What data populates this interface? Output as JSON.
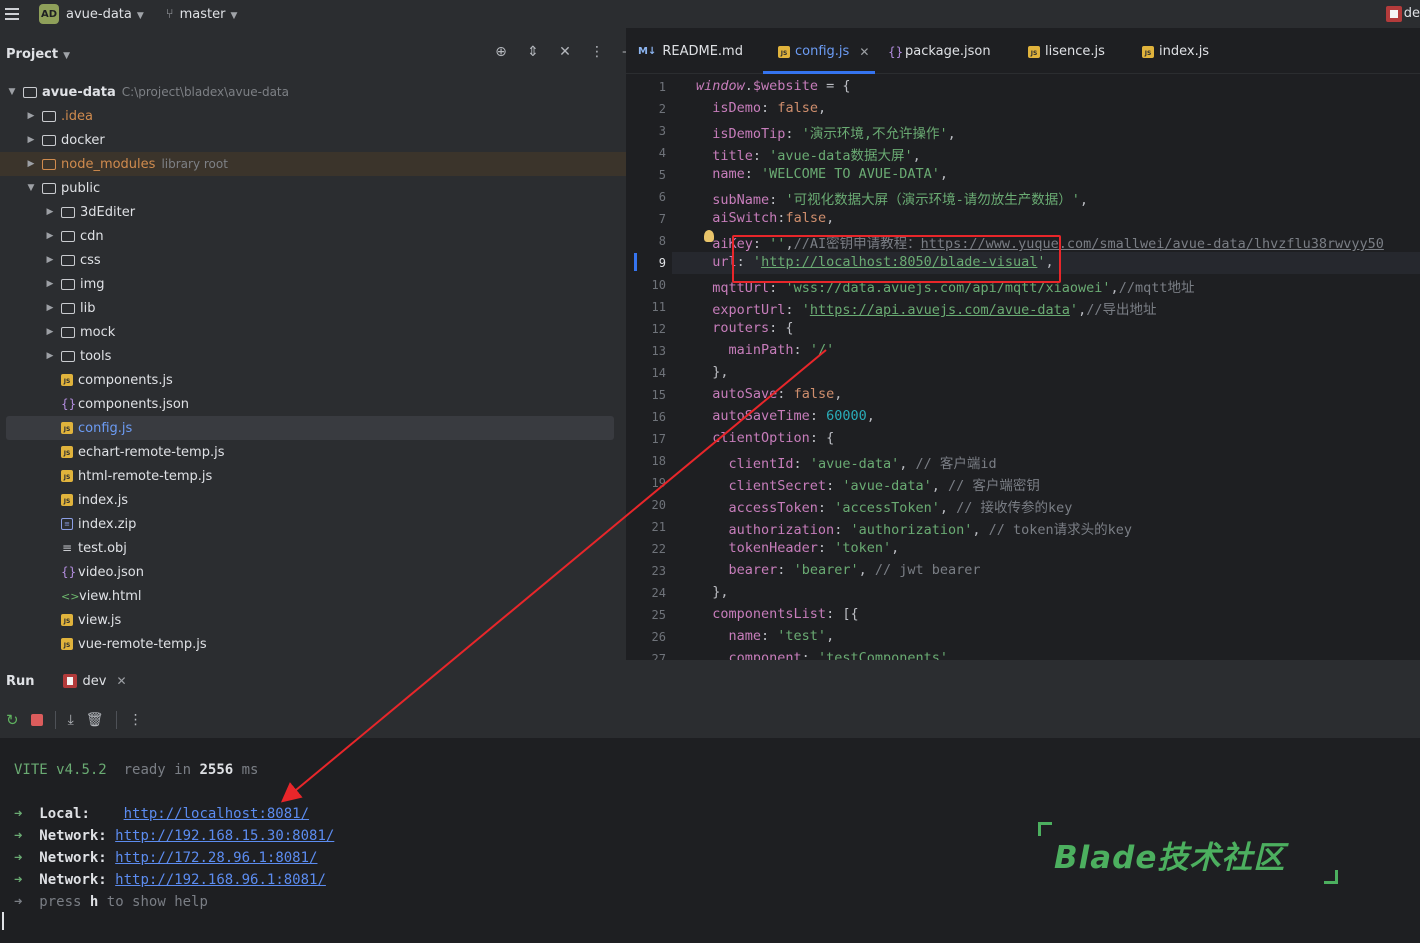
{
  "topbar": {
    "project_badge": "AD",
    "project_name": "avue-data",
    "branch_name": "master",
    "right_text": "de"
  },
  "project_panel": {
    "title": "Project",
    "tools": [
      "⊕",
      "⇕",
      "✕",
      "⋮",
      "—"
    ],
    "tree": [
      {
        "name": "avue-data",
        "hint": "C:\\project\\bladex\\avue-data",
        "type": "folder",
        "depth": 0,
        "expanded": true,
        "bold": true
      },
      {
        "name": ".idea",
        "type": "folder",
        "depth": 1,
        "expanded": false,
        "style": "orange-text"
      },
      {
        "name": "docker",
        "type": "folder",
        "depth": 1,
        "expanded": false
      },
      {
        "name": "node_modules",
        "hint": "library root",
        "type": "folder",
        "depth": 1,
        "expanded": false,
        "style": "excluded"
      },
      {
        "name": "public",
        "type": "folder",
        "depth": 1,
        "expanded": true
      },
      {
        "name": "3dEditer",
        "type": "folder",
        "depth": 2,
        "expanded": false
      },
      {
        "name": "cdn",
        "type": "folder",
        "depth": 2,
        "expanded": false
      },
      {
        "name": "css",
        "type": "folder",
        "depth": 2,
        "expanded": false
      },
      {
        "name": "img",
        "type": "folder",
        "depth": 2,
        "expanded": false
      },
      {
        "name": "lib",
        "type": "folder",
        "depth": 2,
        "expanded": false
      },
      {
        "name": "mock",
        "type": "folder",
        "depth": 2,
        "expanded": false
      },
      {
        "name": "tools",
        "type": "folder",
        "depth": 2,
        "expanded": false
      },
      {
        "name": "components.js",
        "type": "js",
        "depth": 2
      },
      {
        "name": "components.json",
        "type": "json",
        "depth": 2
      },
      {
        "name": "config.js",
        "type": "js",
        "depth": 2,
        "selected": true
      },
      {
        "name": "echart-remote-temp.js",
        "type": "js",
        "depth": 2
      },
      {
        "name": "html-remote-temp.js",
        "type": "js",
        "depth": 2
      },
      {
        "name": "index.js",
        "type": "js",
        "depth": 2
      },
      {
        "name": "index.zip",
        "type": "zip",
        "depth": 2
      },
      {
        "name": "test.obj",
        "type": "obj",
        "depth": 2
      },
      {
        "name": "video.json",
        "type": "json",
        "depth": 2
      },
      {
        "name": "view.html",
        "type": "html",
        "depth": 2
      },
      {
        "name": "view.js",
        "type": "js",
        "depth": 2
      },
      {
        "name": "vue-remote-temp.js",
        "type": "js",
        "depth": 2
      }
    ]
  },
  "editor": {
    "tabs": [
      {
        "label": "README.md",
        "icon": "M↓",
        "active": false
      },
      {
        "label": "config.js",
        "icon": "JS",
        "active": true,
        "closable": true
      },
      {
        "label": "package.json",
        "icon": "{}",
        "active": false
      },
      {
        "label": "lisence.js",
        "icon": "JS",
        "active": false
      },
      {
        "label": "index.js",
        "icon": "JS",
        "active": false
      }
    ],
    "current_line": 9,
    "lines": [
      {
        "n": "1",
        "html": "<span class=\"it\">window</span>.<span class=\"k\">$website</span> = {"
      },
      {
        "n": "2",
        "html": "  <span class=\"p\">isDemo</span>: <span class=\"b\">false</span>,"
      },
      {
        "n": "3",
        "html": "  <span class=\"p\">isDemoTip</span>: <span class=\"s\">'演示环境,不允许操作'</span>,"
      },
      {
        "n": "4",
        "html": "  <span class=\"p\">title</span>: <span class=\"s\">'avue-data数据大屏'</span>,"
      },
      {
        "n": "5",
        "html": "  <span class=\"p\">name</span>: <span class=\"s\">'WELCOME TO AVUE-DATA'</span>,"
      },
      {
        "n": "6",
        "html": "  <span class=\"p\">subName</span>: <span class=\"s\">'可视化数据大屏（演示环境-请勿放生产数据）'</span>,"
      },
      {
        "n": "7",
        "html": "  <span class=\"p\">aiSwitch</span>:<span class=\"b\">false</span>,"
      },
      {
        "n": "8",
        "html": "  <span class=\"p\">aiKey</span>: <span class=\"s\">''</span>,<span class=\"c\">//AI密钥申请教程：<span class=\"u\">https://www.yuque.com/smallwei/avue-data/lhvzflu38rwvyy50</span></span>"
      },
      {
        "n": "9",
        "html": "  <span class=\"p\">url</span>: <span class=\"s\">'<span class=\"u\">http://localhost:8050/blade-visual</span>'</span>,"
      },
      {
        "n": "10",
        "html": "  <span class=\"p\">mqttUrl</span>: <span class=\"s\">'wss://data.avuejs.com/api/mqtt/xiaowei'</span>,<span class=\"c\">//mqtt地址</span>"
      },
      {
        "n": "11",
        "html": "  <span class=\"p\">exportUrl</span>: <span class=\"s\">'<span class=\"u\">https://api.avuejs.com/avue-data</span>'</span>,<span class=\"c\">//导出地址</span>"
      },
      {
        "n": "12",
        "html": "  <span class=\"p\">routers</span>: {"
      },
      {
        "n": "13",
        "html": "    <span class=\"p\">mainPath</span>: <span class=\"s\">'/'</span>"
      },
      {
        "n": "14",
        "html": "  },"
      },
      {
        "n": "15",
        "html": "  <span class=\"p\">autoSave</span>: <span class=\"b\">false</span>,"
      },
      {
        "n": "16",
        "html": "  <span class=\"p\">autoSaveTime</span>: <span class=\"n\">60000</span>,"
      },
      {
        "n": "17",
        "html": "  <span class=\"p\">clientOption</span>: {"
      },
      {
        "n": "18",
        "html": "    <span class=\"p\">clientId</span>: <span class=\"s\">'avue-data'</span>, <span class=\"c\">// 客户端id</span>"
      },
      {
        "n": "19",
        "html": "    <span class=\"p\">clientSecret</span>: <span class=\"s\">'avue-data'</span>, <span class=\"c\">// 客户端密钥</span>"
      },
      {
        "n": "20",
        "html": "    <span class=\"p\">accessToken</span>: <span class=\"s\">'accessToken'</span>, <span class=\"c\">// 接收传参的key</span>"
      },
      {
        "n": "21",
        "html": "    <span class=\"p\">authorization</span>: <span class=\"s\">'authorization'</span>, <span class=\"c\">// token请求头的key</span>"
      },
      {
        "n": "22",
        "html": "    <span class=\"p\">tokenHeader</span>: <span class=\"s\">'token'</span>,"
      },
      {
        "n": "23",
        "html": "    <span class=\"p\">bearer</span>: <span class=\"s\">'bearer'</span>, <span class=\"c\">// jwt bearer</span>"
      },
      {
        "n": "24",
        "html": "  },"
      },
      {
        "n": "25",
        "html": "  <span class=\"p\">componentsList</span>: [{"
      },
      {
        "n": "26",
        "html": "    <span class=\"p\">name</span>: <span class=\"s\">'test'</span>,"
      },
      {
        "n": "27",
        "html": "    <span class=\"p\">component</span>: <span class=\"s\">'testComponents'</span>,"
      }
    ]
  },
  "run_panel": {
    "title": "Run",
    "tab_label": "dev",
    "terminal": {
      "vite_name": "VITE",
      "vite_version": "v4.5.2",
      "ready_prefix": "ready in",
      "ready_ms": "2556",
      "ready_unit": "ms",
      "arrow": "➜",
      "addresses": [
        {
          "label": "Local:  ",
          "url": "http://localhost:8081/"
        },
        {
          "label": "Network:",
          "url": "http://192.168.15.30:8081/"
        },
        {
          "label": "Network:",
          "url": "http://172.28.96.1:8081/"
        },
        {
          "label": "Network:",
          "url": "http://192.168.96.1:8081/"
        }
      ],
      "help_pre": "press",
      "help_key": "h",
      "help_post": "to show help"
    }
  },
  "watermark": {
    "text": "Blade技术社区"
  },
  "colors": {
    "accent": "#3574f0",
    "annotation_red": "#e8262a",
    "watermark_green": "#4caf5f"
  }
}
